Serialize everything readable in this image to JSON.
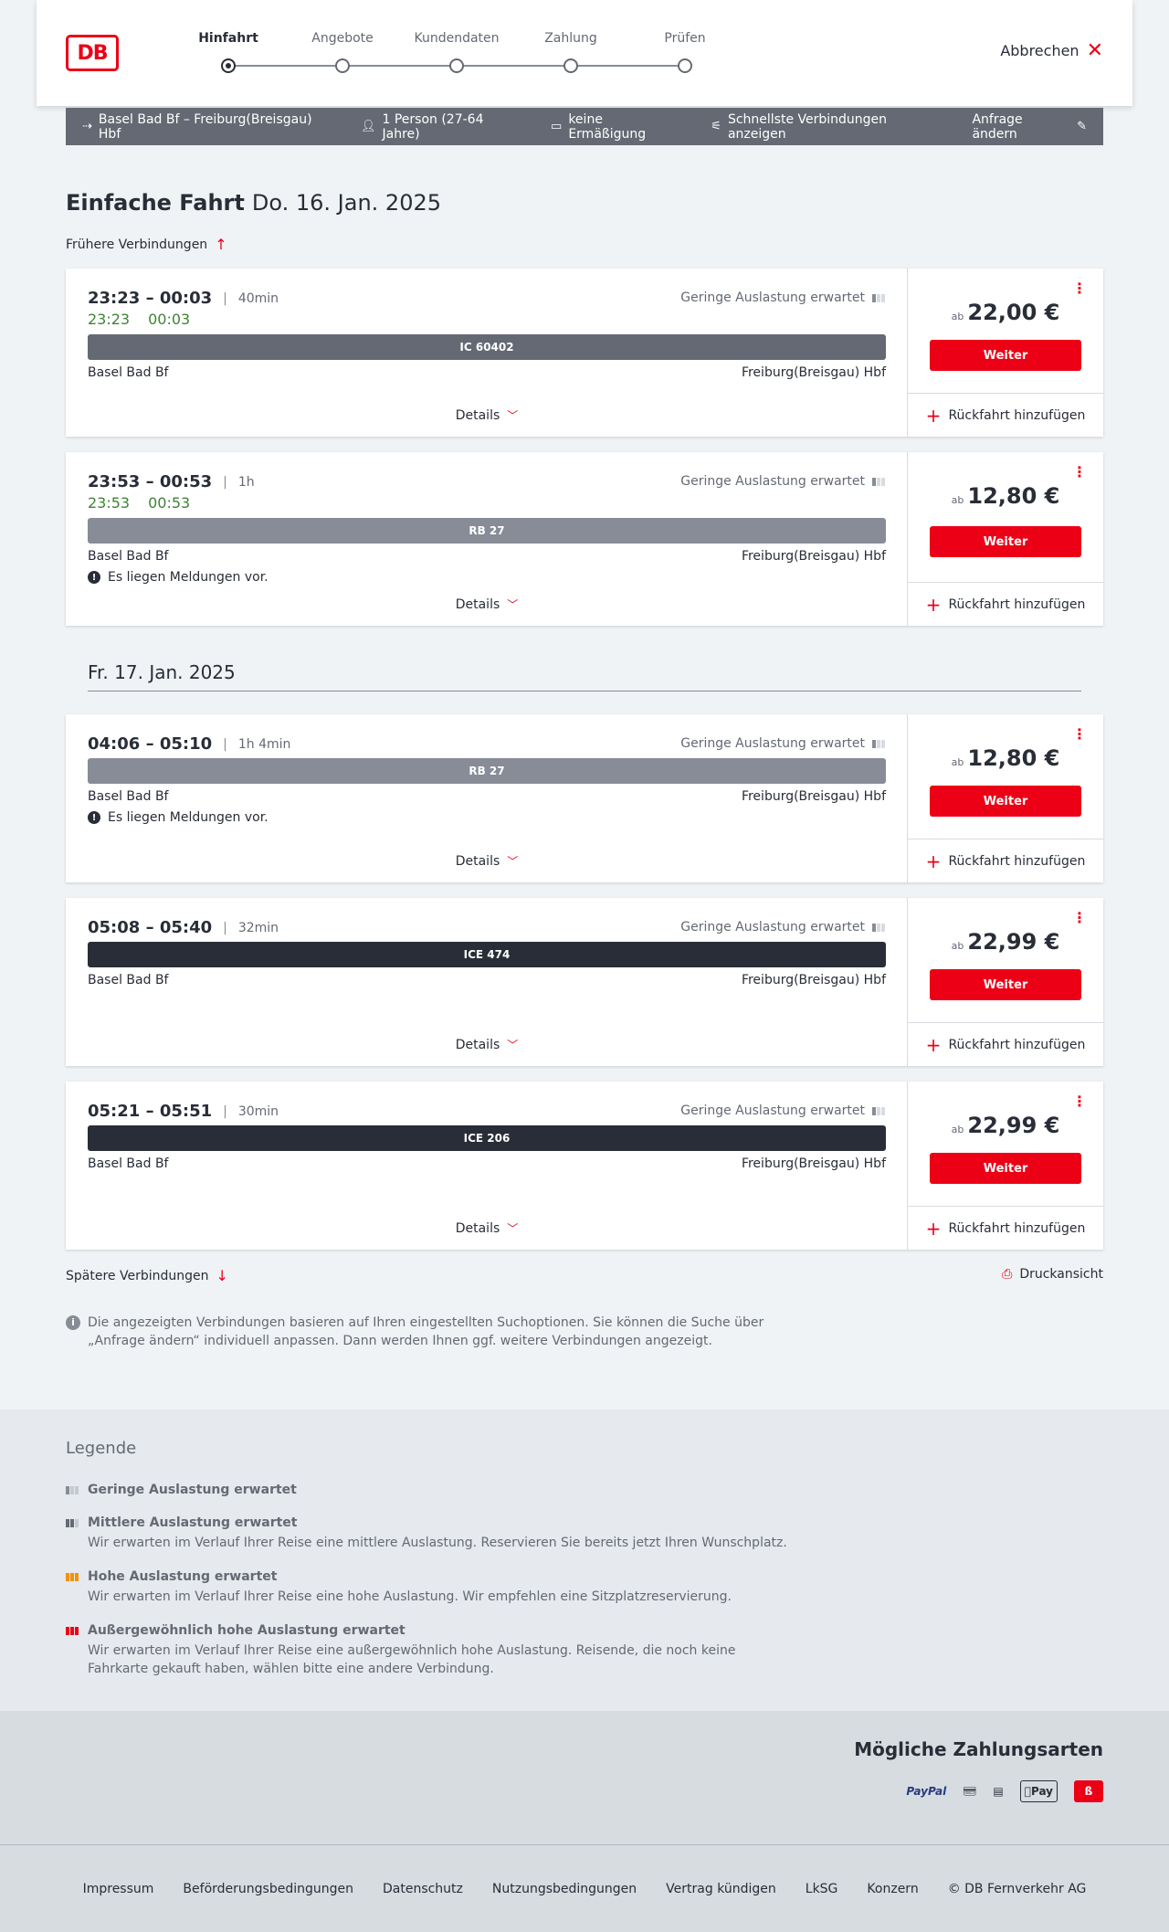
{
  "header": {
    "logo": "DB",
    "steps": [
      "Hinfahrt",
      "Angebote",
      "Kundendaten",
      "Zahlung",
      "Prüfen"
    ],
    "cancel": "Abbrechen"
  },
  "infobar": {
    "route": "Basel Bad Bf – Freiburg(Breisgau) Hbf",
    "persons": "1 Person (27-64 Jahre)",
    "discount": "keine Ermäßigung",
    "fastest": "Schnellste Verbindungen anzeigen",
    "change": "Anfrage ändern"
  },
  "page": {
    "title_bold": "Einfache Fahrt",
    "title_date": "Do. 16. Jan. 2025",
    "earlier": "Frühere Verbindungen",
    "date2": "Fr. 17. Jan. 2025",
    "later": "Spätere Verbindungen",
    "print": "Druckansicht",
    "note": "Die angezeigten Verbindungen basieren auf Ihren eingestellten Suchoptionen. Sie können die Suche über „Anfrage ändern“ individuell anpassen. Dann werden Ihnen ggf. weitere Verbindungen angezeigt."
  },
  "connections": [
    {
      "times": "23:23 – 00:03",
      "duration": "40min",
      "rt_dep": "23:23",
      "rt_arr": "00:03",
      "load": "Geringe Auslastung erwartet",
      "train": "IC 60402",
      "train_color": "#646973",
      "from": "Basel Bad Bf",
      "to": "Freiburg(Breisgau) Hbf",
      "message": "",
      "details": "Details",
      "price_prefix": "ab",
      "price": "22,00 €",
      "button": "Weiter",
      "return": "Rückfahrt hinzufügen"
    },
    {
      "times": "23:53 – 00:53",
      "duration": "1h",
      "rt_dep": "23:53",
      "rt_arr": "00:53",
      "load": "Geringe Auslastung erwartet",
      "train": "RB 27",
      "train_color": "#878c96",
      "from": "Basel Bad Bf",
      "to": "Freiburg(Breisgau) Hbf",
      "message": "Es liegen Meldungen vor.",
      "details": "Details",
      "price_prefix": "ab",
      "price": "12,80 €",
      "button": "Weiter",
      "return": "Rückfahrt hinzufügen"
    },
    {
      "times": "04:06 – 05:10",
      "duration": "1h 4min",
      "load": "Geringe Auslastung erwartet",
      "train": "RB 27",
      "train_color": "#878c96",
      "from": "Basel Bad Bf",
      "to": "Freiburg(Breisgau) Hbf",
      "message": "Es liegen Meldungen vor.",
      "details": "Details",
      "price_prefix": "ab",
      "price": "12,80 €",
      "button": "Weiter",
      "return": "Rückfahrt hinzufügen"
    },
    {
      "times": "05:08 – 05:40",
      "duration": "32min",
      "load": "Geringe Auslastung erwartet",
      "train": "ICE 474",
      "train_color": "#282d37",
      "from": "Basel Bad Bf",
      "to": "Freiburg(Breisgau) Hbf",
      "message": "",
      "details": "Details",
      "price_prefix": "ab",
      "price": "22,99 €",
      "button": "Weiter",
      "return": "Rückfahrt hinzufügen"
    },
    {
      "times": "05:21 – 05:51",
      "duration": "30min",
      "load": "Geringe Auslastung erwartet",
      "train": "ICE 206",
      "train_color": "#282d37",
      "from": "Basel Bad Bf",
      "to": "Freiburg(Breisgau) Hbf",
      "message": "",
      "details": "Details",
      "price_prefix": "ab",
      "price": "22,99 €",
      "button": "Weiter",
      "return": "Rückfahrt hinzufügen"
    }
  ],
  "legend": {
    "title": "Legende",
    "items": [
      {
        "title": "Geringe Auslastung erwartet",
        "desc": "",
        "color": "#878c96"
      },
      {
        "title": "Mittlere Auslastung erwartet",
        "desc": "Wir erwarten im Verlauf Ihrer Reise eine mittlere Auslastung. Reservieren Sie bereits jetzt Ihren Wunschplatz.",
        "color": "#646973"
      },
      {
        "title": "Hohe Auslastung erwartet",
        "desc": "Wir erwarten im Verlauf Ihrer Reise eine hohe Auslastung. Wir empfehlen eine Sitzplatzreservierung.",
        "color": "#f39200"
      },
      {
        "title": "Außergewöhnlich hohe Auslastung erwartet",
        "desc": "Wir erwarten im Verlauf Ihrer Reise eine außergewöhnlich hohe Auslastung. Reisende, die noch keine Fahrkarte gekauft haben, wählen bitte eine andere Verbindung.",
        "color": "#ec0016"
      }
    ]
  },
  "payment": {
    "title": "Mögliche Zahlungsarten",
    "methods": [
      "PayPal",
      "Pay"
    ]
  },
  "footer": [
    "Impressum",
    "Beförderungsbedingungen",
    "Datenschutz",
    "Nutzungsbedingungen",
    "Vertrag kündigen",
    "LkSG",
    "Konzern",
    "© DB Fernverkehr AG"
  ]
}
